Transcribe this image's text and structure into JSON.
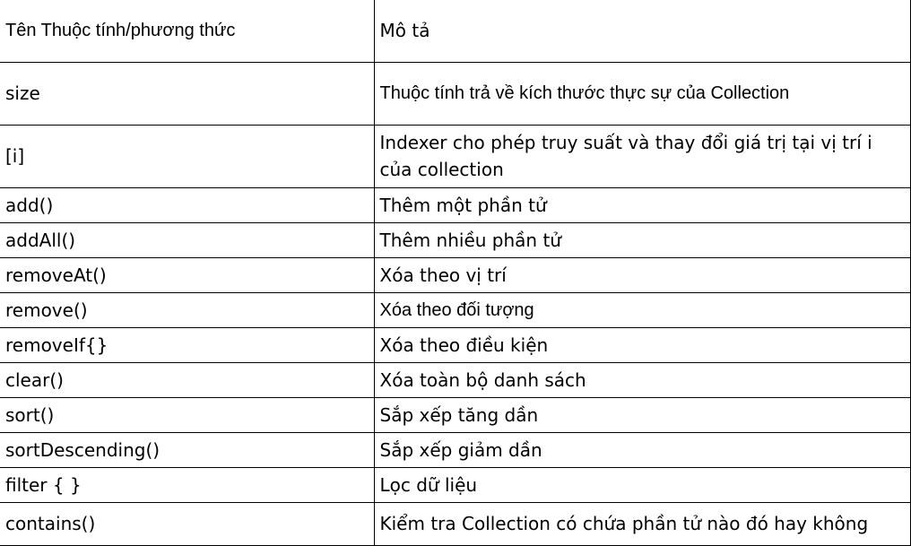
{
  "table": {
    "header": {
      "name": "Tên Thuộc tính/phương thức",
      "description": "Mô tả"
    },
    "rows": [
      {
        "name": "size",
        "description": "Thuộc tính trả về kích thước thực sự của Collection"
      },
      {
        "name": "[i]",
        "description": "Indexer cho phép truy suất và thay đổi giá trị tại vị trí i của collection"
      },
      {
        "name": "add()",
        "description": "Thêm một phần tử"
      },
      {
        "name": "addAll()",
        "description": "Thêm nhiều phần tử"
      },
      {
        "name": "removeAt()",
        "description": "Xóa theo vị trí"
      },
      {
        "name": "remove()",
        "description": "Xóa theo đối tượng"
      },
      {
        "name": "removeIf{}",
        "description": "Xóa theo điều kiện"
      },
      {
        "name": "clear()",
        "description": "Xóa toàn bộ danh sách"
      },
      {
        "name": "sort()",
        "description": "Sắp xếp tăng dần"
      },
      {
        "name": "sortDescending()",
        "description": "Sắp xếp giảm dần"
      },
      {
        "name": "filter {  }",
        "description": "Lọc dữ liệu"
      },
      {
        "name": "contains()",
        "description": "Kiểm tra Collection có chứa phần tử nào đó hay không"
      }
    ]
  }
}
